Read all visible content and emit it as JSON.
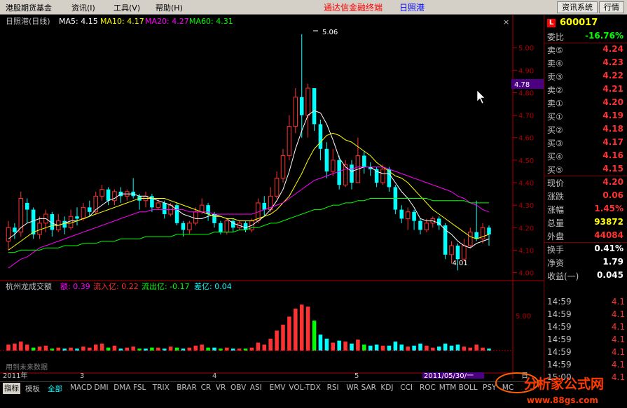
{
  "menubar": {
    "items": [
      "港股期货基金",
      "资讯(I)",
      "工具(V)",
      "帮助(H)"
    ],
    "app_title": "通达信金融终端",
    "stock_title": "日照港",
    "right_buttons": [
      "资讯系统",
      "行情"
    ]
  },
  "chart": {
    "title": "日照港(日线)",
    "ma": [
      {
        "label": "MA5: 4.15",
        "color": "#ffffff"
      },
      {
        "label": "MA10: 4.17",
        "color": "#ffff00"
      },
      {
        "label": "MA20: 4.27",
        "color": "#ff00ff"
      },
      {
        "label": "MA60: 4.31",
        "color": "#00ff00"
      }
    ],
    "high_label": "5.06",
    "low_label": "4.01",
    "price_tag": "4.78",
    "y_labels": [
      "5.00",
      "4.90",
      "4.80",
      "4.70",
      "4.60",
      "4.50",
      "4.40",
      "4.30",
      "4.20",
      "4.10",
      "4.00"
    ],
    "vol_title": "杭州龙成交额",
    "vol_indicators": [
      {
        "label": "额: 0.39",
        "color": "#ff00ff"
      },
      {
        "label": "流入亿: 0.22",
        "color": "#ff3232"
      },
      {
        "label": "流出亿: -0.17",
        "color": "#00ff00"
      },
      {
        "label": "差亿: 0.04",
        "color": "#00ffff"
      }
    ],
    "vol_y_label": "5.00",
    "watermark": "用到未来数据",
    "x_labels": [
      "2011年",
      "3",
      "4",
      "5"
    ],
    "cursor_date": "2011/05/30/一",
    "right_axis_char": "日"
  },
  "chart_data": {
    "type": "candlestick",
    "title": "日照港(日线)",
    "price_range": [
      3.98,
      5.1
    ],
    "high": 5.06,
    "low": 4.01,
    "ma_latest": {
      "MA5": 4.15,
      "MA10": 4.17,
      "MA20": 4.27,
      "MA60": 4.31
    },
    "candles": [
      [
        4.14,
        4.2,
        4.23,
        4.1
      ],
      [
        4.2,
        4.18,
        4.22,
        4.15
      ],
      [
        4.18,
        4.33,
        4.36,
        4.16
      ],
      [
        4.31,
        4.28,
        4.33,
        4.22
      ],
      [
        4.28,
        4.17,
        4.29,
        4.15
      ],
      [
        4.17,
        4.22,
        4.25,
        4.15
      ],
      [
        4.22,
        4.26,
        4.28,
        4.18
      ],
      [
        4.26,
        4.19,
        4.27,
        4.16
      ],
      [
        4.19,
        4.23,
        4.26,
        4.18
      ],
      [
        4.23,
        4.2,
        4.25,
        4.17
      ],
      [
        4.2,
        4.25,
        4.28,
        4.19
      ],
      [
        4.25,
        4.24,
        4.29,
        4.21
      ],
      [
        4.24,
        4.29,
        4.31,
        4.23
      ],
      [
        4.29,
        4.27,
        4.32,
        4.25
      ],
      [
        4.27,
        4.34,
        4.36,
        4.26
      ],
      [
        4.34,
        4.37,
        4.39,
        4.32
      ],
      [
        4.37,
        4.32,
        4.38,
        4.3
      ],
      [
        4.32,
        4.36,
        4.37,
        4.3
      ],
      [
        4.36,
        4.34,
        4.38,
        4.31
      ],
      [
        4.34,
        4.36,
        4.37,
        4.32
      ],
      [
        4.36,
        4.34,
        4.42,
        4.33
      ],
      [
        4.34,
        4.32,
        4.35,
        4.28
      ],
      [
        4.32,
        4.34,
        4.36,
        4.29
      ],
      [
        4.34,
        4.29,
        4.35,
        4.27
      ],
      [
        4.29,
        4.31,
        4.33,
        4.28
      ],
      [
        4.31,
        4.26,
        4.32,
        4.24
      ],
      [
        4.26,
        4.3,
        4.31,
        4.25
      ],
      [
        4.3,
        4.22,
        4.31,
        4.21
      ],
      [
        4.22,
        4.19,
        4.23,
        4.16
      ],
      [
        4.19,
        4.22,
        4.23,
        4.17
      ],
      [
        4.22,
        4.27,
        4.29,
        4.21
      ],
      [
        4.27,
        4.3,
        4.33,
        4.26
      ],
      [
        4.3,
        4.26,
        4.31,
        4.23
      ],
      [
        4.26,
        4.22,
        4.27,
        4.2
      ],
      [
        4.22,
        4.18,
        4.23,
        4.17
      ],
      [
        4.18,
        4.23,
        4.24,
        4.17
      ],
      [
        4.23,
        4.2,
        4.24,
        4.18
      ],
      [
        4.2,
        4.22,
        4.23,
        4.19
      ],
      [
        4.22,
        4.19,
        4.23,
        4.18
      ],
      [
        4.19,
        4.23,
        4.24,
        4.18
      ],
      [
        4.23,
        4.31,
        4.33,
        4.22
      ],
      [
        4.31,
        4.28,
        4.34,
        4.25
      ],
      [
        4.28,
        4.34,
        4.38,
        4.27
      ],
      [
        4.34,
        4.42,
        4.45,
        4.33
      ],
      [
        4.42,
        4.52,
        4.55,
        4.4
      ],
      [
        4.52,
        4.65,
        4.7,
        4.5
      ],
      [
        4.65,
        4.78,
        4.82,
        4.62
      ],
      [
        4.78,
        4.7,
        5.06,
        4.6
      ],
      [
        4.7,
        4.82,
        4.84,
        4.6
      ],
      [
        4.82,
        4.66,
        4.82,
        4.63
      ],
      [
        4.66,
        4.55,
        4.68,
        4.5
      ],
      [
        4.55,
        4.45,
        4.58,
        4.42
      ],
      [
        4.45,
        4.5,
        4.55,
        4.43
      ],
      [
        4.5,
        4.39,
        4.52,
        4.37
      ],
      [
        4.39,
        4.48,
        4.5,
        4.38
      ],
      [
        4.48,
        4.4,
        4.5,
        4.37
      ],
      [
        4.4,
        4.52,
        4.6,
        4.4
      ],
      [
        4.52,
        4.47,
        4.54,
        4.44
      ],
      [
        4.47,
        4.46,
        4.49,
        4.43
      ],
      [
        4.46,
        4.4,
        4.47,
        4.38
      ],
      [
        4.4,
        4.46,
        4.48,
        4.39
      ],
      [
        4.46,
        4.38,
        4.47,
        4.36
      ],
      [
        4.38,
        4.28,
        4.39,
        4.26
      ],
      [
        4.28,
        4.24,
        4.3,
        4.22
      ],
      [
        4.24,
        4.27,
        4.29,
        4.19
      ],
      [
        4.27,
        4.23,
        4.28,
        4.19
      ],
      [
        4.23,
        4.19,
        4.24,
        4.17
      ],
      [
        4.19,
        4.22,
        4.24,
        4.18
      ],
      [
        4.22,
        4.24,
        4.25,
        4.2
      ],
      [
        4.24,
        4.21,
        4.25,
        4.19
      ],
      [
        4.21,
        4.08,
        4.22,
        4.06
      ],
      [
        4.08,
        4.12,
        4.14,
        4.04
      ],
      [
        4.12,
        4.06,
        4.13,
        4.01
      ],
      [
        4.06,
        4.12,
        4.15,
        4.05
      ],
      [
        4.12,
        4.18,
        4.2,
        4.11
      ],
      [
        4.18,
        4.15,
        4.32,
        4.14
      ],
      [
        4.15,
        4.2,
        4.22,
        4.13
      ],
      [
        4.2,
        4.17,
        4.21,
        4.12
      ]
    ],
    "ma5": [
      4.15,
      4.17,
      4.2,
      4.22,
      4.23,
      4.24,
      4.24,
      4.22,
      4.21,
      4.22,
      4.23,
      4.23,
      4.24,
      4.25,
      4.28,
      4.3,
      4.32,
      4.33,
      4.35,
      4.35,
      4.35,
      4.34,
      4.34,
      4.33,
      4.32,
      4.31,
      4.3,
      4.28,
      4.26,
      4.25,
      4.24,
      4.24,
      4.25,
      4.26,
      4.25,
      4.24,
      4.22,
      4.21,
      4.2,
      4.21,
      4.23,
      4.25,
      4.28,
      4.32,
      4.37,
      4.45,
      4.55,
      4.63,
      4.7,
      4.72,
      4.71,
      4.66,
      4.59,
      4.51,
      4.47,
      4.45,
      4.46,
      4.47,
      4.47,
      4.45,
      4.44,
      4.44,
      4.4,
      4.36,
      4.33,
      4.29,
      4.24,
      4.23,
      4.23,
      4.22,
      4.19,
      4.17,
      4.14,
      4.12,
      4.11,
      4.13,
      4.14,
      4.15
    ],
    "ma10": [
      4.1,
      4.12,
      4.14,
      4.16,
      4.18,
      4.19,
      4.2,
      4.21,
      4.21,
      4.22,
      4.22,
      4.23,
      4.24,
      4.25,
      4.26,
      4.27,
      4.28,
      4.29,
      4.3,
      4.31,
      4.32,
      4.33,
      4.33,
      4.33,
      4.33,
      4.33,
      4.32,
      4.31,
      4.3,
      4.29,
      4.28,
      4.27,
      4.26,
      4.25,
      4.25,
      4.24,
      4.24,
      4.23,
      4.23,
      4.23,
      4.24,
      4.25,
      4.26,
      4.28,
      4.31,
      4.34,
      4.39,
      4.44,
      4.5,
      4.55,
      4.58,
      4.61,
      4.62,
      4.61,
      4.59,
      4.58,
      4.56,
      4.54,
      4.52,
      4.49,
      4.47,
      4.45,
      4.43,
      4.42,
      4.4,
      4.37,
      4.34,
      4.31,
      4.28,
      4.26,
      4.24,
      4.22,
      4.2,
      4.18,
      4.16,
      4.15,
      4.16,
      4.17
    ],
    "ma20": [
      4.02,
      4.04,
      4.06,
      4.07,
      4.09,
      4.11,
      4.12,
      4.13,
      4.14,
      4.15,
      4.16,
      4.17,
      4.18,
      4.19,
      4.2,
      4.21,
      4.22,
      4.23,
      4.24,
      4.25,
      4.26,
      4.27,
      4.27,
      4.28,
      4.28,
      4.28,
      4.28,
      4.28,
      4.28,
      4.27,
      4.27,
      4.27,
      4.27,
      4.26,
      4.26,
      4.26,
      4.26,
      4.26,
      4.26,
      4.26,
      4.27,
      4.28,
      4.29,
      4.3,
      4.31,
      4.33,
      4.35,
      4.37,
      4.39,
      4.41,
      4.42,
      4.43,
      4.44,
      4.45,
      4.46,
      4.46,
      4.47,
      4.47,
      4.47,
      4.47,
      4.47,
      4.46,
      4.45,
      4.44,
      4.43,
      4.42,
      4.41,
      4.4,
      4.39,
      4.38,
      4.37,
      4.36,
      4.34,
      4.33,
      4.31,
      4.3,
      4.28,
      4.27
    ],
    "ma60": [
      4.09,
      4.09,
      4.1,
      4.1,
      4.1,
      4.1,
      4.11,
      4.11,
      4.11,
      4.12,
      4.12,
      4.12,
      4.13,
      4.13,
      4.13,
      4.14,
      4.14,
      4.14,
      4.15,
      4.15,
      4.15,
      4.15,
      4.16,
      4.16,
      4.16,
      4.16,
      4.16,
      4.17,
      4.17,
      4.17,
      4.17,
      4.17,
      4.17,
      4.18,
      4.18,
      4.18,
      4.18,
      4.19,
      4.19,
      4.2,
      4.2,
      4.21,
      4.22,
      4.22,
      4.23,
      4.24,
      4.25,
      4.26,
      4.27,
      4.28,
      4.28,
      4.29,
      4.3,
      4.3,
      4.31,
      4.31,
      4.32,
      4.32,
      4.33,
      4.33,
      4.33,
      4.33,
      4.33,
      4.33,
      4.33,
      4.33,
      4.33,
      4.33,
      4.32,
      4.32,
      4.32,
      4.32,
      4.32,
      4.32,
      4.31,
      4.31,
      4.31,
      4.31
    ],
    "volume_range": [
      0,
      5.6
    ],
    "volume": [
      [
        0.6,
        "r"
      ],
      [
        0.7,
        "r"
      ],
      [
        0.9,
        "r"
      ],
      [
        0.6,
        "r"
      ],
      [
        0.3,
        "g"
      ],
      [
        0.4,
        "r"
      ],
      [
        0.5,
        "r"
      ],
      [
        0.2,
        "g"
      ],
      [
        0.3,
        "r"
      ],
      [
        0.2,
        "c"
      ],
      [
        0.3,
        "r"
      ],
      [
        0.2,
        "c"
      ],
      [
        0.4,
        "r"
      ],
      [
        0.3,
        "r"
      ],
      [
        0.6,
        "r"
      ],
      [
        0.7,
        "r"
      ],
      [
        0.3,
        "g"
      ],
      [
        0.5,
        "r"
      ],
      [
        0.2,
        "c"
      ],
      [
        0.3,
        "r"
      ],
      [
        0.4,
        "r"
      ],
      [
        0.2,
        "g"
      ],
      [
        0.2,
        "c"
      ],
      [
        0.3,
        "g"
      ],
      [
        0.3,
        "r"
      ],
      [
        0.2,
        "c"
      ],
      [
        0.4,
        "r"
      ],
      [
        0.3,
        "g"
      ],
      [
        0.2,
        "c"
      ],
      [
        0.3,
        "r"
      ],
      [
        0.5,
        "r"
      ],
      [
        0.6,
        "r"
      ],
      [
        0.3,
        "g"
      ],
      [
        0.3,
        "c"
      ],
      [
        0.2,
        "g"
      ],
      [
        0.3,
        "r"
      ],
      [
        0.2,
        "c"
      ],
      [
        0.2,
        "r"
      ],
      [
        0.2,
        "g"
      ],
      [
        0.3,
        "r"
      ],
      [
        0.8,
        "r"
      ],
      [
        0.6,
        "r"
      ],
      [
        1.2,
        "r"
      ],
      [
        2.0,
        "r"
      ],
      [
        2.6,
        "r"
      ],
      [
        3.4,
        "r"
      ],
      [
        4.2,
        "r"
      ],
      [
        4.6,
        "r"
      ],
      [
        4.4,
        "r"
      ],
      [
        3.0,
        "g"
      ],
      [
        1.6,
        "c"
      ],
      [
        1.2,
        "c"
      ],
      [
        0.8,
        "r"
      ],
      [
        1.0,
        "c"
      ],
      [
        0.9,
        "r"
      ],
      [
        0.7,
        "c"
      ],
      [
        1.1,
        "r"
      ],
      [
        0.6,
        "g"
      ],
      [
        0.5,
        "c"
      ],
      [
        0.6,
        "c"
      ],
      [
        0.5,
        "r"
      ],
      [
        0.5,
        "c"
      ],
      [
        0.9,
        "c"
      ],
      [
        0.6,
        "c"
      ],
      [
        0.4,
        "r"
      ],
      [
        0.5,
        "c"
      ],
      [
        0.7,
        "c"
      ],
      [
        0.5,
        "r"
      ],
      [
        0.3,
        "r"
      ],
      [
        0.4,
        "c"
      ],
      [
        0.7,
        "c"
      ],
      [
        0.5,
        "c"
      ],
      [
        0.6,
        "c"
      ],
      [
        0.4,
        "r"
      ],
      [
        0.3,
        "r"
      ],
      [
        0.6,
        "r"
      ],
      [
        0.3,
        "r"
      ],
      [
        0.2,
        "c"
      ]
    ]
  },
  "quote": {
    "code": "600017",
    "rows": [
      {
        "label": "委比",
        "value": "-16.76%",
        "color": "#00ff00"
      },
      {
        "label": "卖⑤",
        "value": "4.24",
        "color": "#ff3232"
      },
      {
        "label": "卖④",
        "value": "4.23",
        "color": "#ff3232"
      },
      {
        "label": "卖③",
        "value": "4.22",
        "color": "#ff3232"
      },
      {
        "label": "卖②",
        "value": "4.21",
        "color": "#ff3232"
      },
      {
        "label": "卖①",
        "value": "4.20",
        "color": "#ff3232"
      },
      {
        "label": "买①",
        "value": "4.19",
        "color": "#ff3232"
      },
      {
        "label": "买②",
        "value": "4.18",
        "color": "#ff3232"
      },
      {
        "label": "买③",
        "value": "4.17",
        "color": "#ff3232"
      },
      {
        "label": "买④",
        "value": "4.16",
        "color": "#ff3232"
      },
      {
        "label": "买⑤",
        "value": "4.15",
        "color": "#ff3232"
      },
      {
        "label": "现价",
        "value": "4.20",
        "color": "#ff3232"
      },
      {
        "label": "涨跌",
        "value": "0.06",
        "color": "#ff3232"
      },
      {
        "label": "涨幅",
        "value": "1.45%",
        "color": "#ff3232"
      },
      {
        "label": "总量",
        "value": "93872",
        "color": "#ffff00"
      },
      {
        "label": "外盘",
        "value": "44084",
        "color": "#ff3232"
      },
      {
        "label": "换手",
        "value": "0.41%",
        "color": "#ffffff"
      },
      {
        "label": "净资",
        "value": "1.79",
        "color": "#ffffff"
      },
      {
        "label": "收益(一)",
        "value": "0.045",
        "color": "#ffffff"
      }
    ],
    "ticks": [
      {
        "time": "14:59",
        "price": "4.1"
      },
      {
        "time": "14:59",
        "price": "4.1"
      },
      {
        "time": "14:59",
        "price": "4.1"
      },
      {
        "time": "14:59",
        "price": "4.1"
      },
      {
        "time": "14:59",
        "price": "4.1"
      },
      {
        "time": "14:59",
        "price": "4.1"
      },
      {
        "time": "15:00",
        "price": "4.1"
      }
    ]
  },
  "tabs": [
    "指标",
    "模板",
    "全部",
    "MACD",
    "DMI",
    "DMA",
    "FSL",
    "TRIX",
    "BRAR",
    "CR",
    "VR",
    "OBV",
    "ASI",
    "EMV",
    "VOL-TDX",
    "RSI",
    "WR",
    "SAR",
    "KDJ",
    "CCI",
    "ROC",
    "MTM",
    "BOLL",
    "PSY",
    "MC"
  ],
  "logo": {
    "name": "分析家公式网",
    "url": "www.88gs.com"
  }
}
